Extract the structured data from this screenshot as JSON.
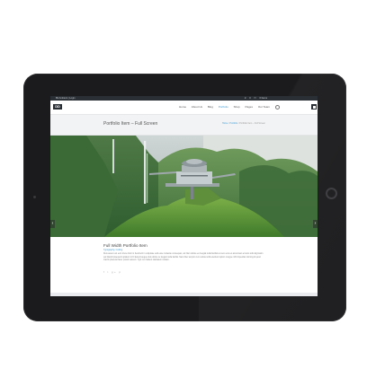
{
  "topbar": {
    "left_text": "Bit Ambient   |   Login",
    "right_items": [
      "♥",
      "0",
      "☐",
      "0 Items"
    ]
  },
  "header": {
    "logo_text": "DD",
    "nav_items": [
      {
        "label": "Home",
        "active": false
      },
      {
        "label": "About Us",
        "active": false
      },
      {
        "label": "Blog",
        "active": false
      },
      {
        "label": "Portfolio",
        "active": true
      },
      {
        "label": "Shop",
        "active": false
      },
      {
        "label": "Pages",
        "active": false
      },
      {
        "label": "Our Team",
        "active": false
      }
    ]
  },
  "titlebar": {
    "title": "Portfolio Item – Full Screen",
    "breadcrumb_home": "Home",
    "breadcrumb_sep": " / ",
    "breadcrumb_section": "Portfolio",
    "breadcrumb_current": "Portfolio Item – Full Screen"
  },
  "post": {
    "title": "Full Width Portfolio Item",
    "category": "Typography, Coding",
    "text": "Duis autem vel eum iriure dolor in hendrerit in vulputate velit esse molestie consequat, vel illum dolore eu feugiat nulla facilisis at vero eros et accumsan et iusto odio dignissim qui blandit praesent luptatum zzril delenit augue duis dolore te feugait nulla facilisi. Nam liber tempor cum soluta nobis eleifend option congue nihil imperdiet doming id quod mazim placerat facer possim assum. Typi non habent claritatem insitam.",
    "share_icons": "f t g+ p"
  }
}
